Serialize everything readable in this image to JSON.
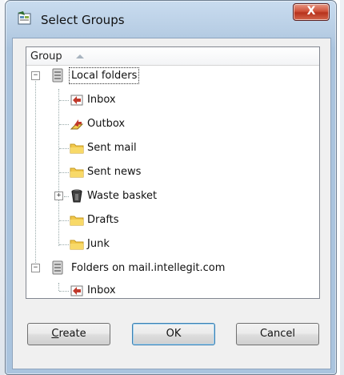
{
  "window": {
    "title": "Select Groups",
    "close_label": "X"
  },
  "tree": {
    "column_header": "Group",
    "nodes": [
      {
        "label": "Local folders",
        "icon": "server-icon",
        "level": 0,
        "expander": "−",
        "selected": true
      },
      {
        "label": "Inbox",
        "icon": "inbox-icon",
        "level": 1
      },
      {
        "label": "Outbox",
        "icon": "outbox-icon",
        "level": 1
      },
      {
        "label": "Sent mail",
        "icon": "folder-icon",
        "level": 1
      },
      {
        "label": "Sent news",
        "icon": "folder-icon",
        "level": 1
      },
      {
        "label": "Waste basket",
        "icon": "trash-icon",
        "level": 1,
        "expander": "+"
      },
      {
        "label": "Drafts",
        "icon": "folder-icon",
        "level": 1
      },
      {
        "label": "Junk",
        "icon": "folder-icon",
        "level": 1
      },
      {
        "label": "Folders on mail.intellegit.com",
        "icon": "server-icon",
        "level": 0,
        "expander": "−"
      },
      {
        "label": "Inbox",
        "icon": "inbox-icon",
        "level": 1
      }
    ]
  },
  "buttons": {
    "create": {
      "mnemonic": "C",
      "rest": "reate"
    },
    "ok": "OK",
    "cancel": "Cancel"
  },
  "colors": {
    "selection_outline": "#333333",
    "folder": "#f2c84b",
    "close_button": "#c8462c"
  }
}
